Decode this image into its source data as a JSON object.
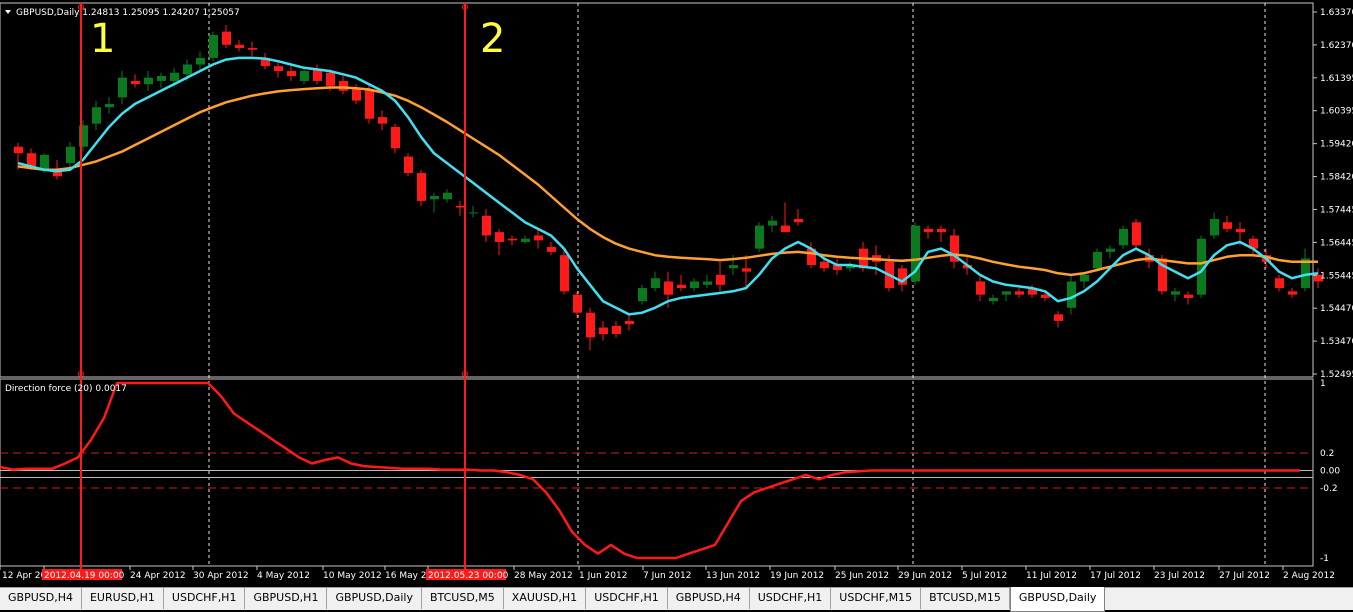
{
  "window": {
    "symbol_info": "GBPUSD,Daily  1.24813 1.25095 1.24207 1.25057",
    "indicator_label": "Direction force (20) 0.0017"
  },
  "annotations": {
    "marker_1": "1",
    "marker_2": "2"
  },
  "main_price_axis": [
    "1.63370",
    "1.62370",
    "1.61395",
    "1.60395",
    "1.59420",
    "1.58420",
    "1.57445",
    "1.56445",
    "1.55445",
    "1.54470",
    "1.53470",
    "1.52495"
  ],
  "indicator_axis": [
    "1",
    "0.2",
    "0.00",
    "-0.2",
    "-1"
  ],
  "time_axis": [
    "12 Apr 20",
    "2012.04.19 00:00",
    "24 Apr 2012",
    "30 Apr 2012",
    "4 May 2012",
    "10 May 2012",
    "16 May 2",
    "2012.05.23 00:00",
    "28 May 2012",
    "1 Jun 2012",
    "7 Jun 2012",
    "13 Jun 2012",
    "19 Jun 2012",
    "25 Jun 2012",
    "29 Jun 2012",
    "5 Jul 2012",
    "11 Jul 2012",
    "17 Jul 2012",
    "23 Jul 2012",
    "27 Jul 2012",
    "2 Aug 2012"
  ],
  "tabs": [
    {
      "label": "GBPUSD,H4",
      "active": false
    },
    {
      "label": "EURUSD,H1",
      "active": false
    },
    {
      "label": "USDCHF,H1",
      "active": false
    },
    {
      "label": "GBPUSD,H1",
      "active": false
    },
    {
      "label": "GBPUSD,Daily",
      "active": false
    },
    {
      "label": "BTCUSD,M5",
      "active": false
    },
    {
      "label": "XAUUSD,H1",
      "active": false
    },
    {
      "label": "USDCHF,H1",
      "active": false
    },
    {
      "label": "GBPUSD,H4",
      "active": false
    },
    {
      "label": "USDCHF,H1",
      "active": false
    },
    {
      "label": "USDCHF,M15",
      "active": false
    },
    {
      "label": "BTCUSD,M15",
      "active": false
    },
    {
      "label": "GBPUSD,Daily",
      "active": true
    }
  ],
  "colors": {
    "bull": "#0b7a1e",
    "bear": "#ff1a1a",
    "ma_fast": "#40e0f0",
    "ma_slow": "#ffa030",
    "indicator": "#ff1a1a",
    "marker_text": "#ffff40",
    "grid": "#ffffff"
  },
  "chart_data": {
    "type": "candlestick",
    "symbol": "GBPUSD",
    "timeframe": "Daily",
    "ylim": [
      1.52495,
      1.6387
    ],
    "candles": [
      [
        1.595,
        1.5962,
        1.588,
        1.593
      ],
      [
        1.593,
        1.5945,
        1.588,
        1.589
      ],
      [
        1.588,
        1.593,
        1.587,
        1.5925
      ],
      [
        1.588,
        1.591,
        1.585,
        1.586
      ],
      [
        1.59,
        1.5965,
        1.588,
        1.595
      ],
      [
        1.595,
        1.603,
        1.5935,
        1.6015
      ],
      [
        1.602,
        1.609,
        1.6,
        1.607
      ],
      [
        1.607,
        1.61,
        1.605,
        1.608
      ],
      [
        1.61,
        1.618,
        1.608,
        1.616
      ],
      [
        1.615,
        1.617,
        1.613,
        1.614
      ],
      [
        1.614,
        1.618,
        1.612,
        1.616
      ],
      [
        1.615,
        1.6175,
        1.613,
        1.6165
      ],
      [
        1.615,
        1.619,
        1.613,
        1.6175
      ],
      [
        1.617,
        1.6215,
        1.615,
        1.62
      ],
      [
        1.62,
        1.624,
        1.618,
        1.622
      ],
      [
        1.622,
        1.63,
        1.621,
        1.629
      ],
      [
        1.63,
        1.632,
        1.625,
        1.626
      ],
      [
        1.626,
        1.6275,
        1.624,
        1.625
      ],
      [
        1.625,
        1.627,
        1.6225,
        1.6245
      ],
      [
        1.622,
        1.6235,
        1.6185,
        1.6195
      ],
      [
        1.6195,
        1.621,
        1.616,
        1.618
      ],
      [
        1.618,
        1.62,
        1.615,
        1.6165
      ],
      [
        1.615,
        1.619,
        1.614,
        1.618
      ],
      [
        1.6185,
        1.62,
        1.614,
        1.615
      ],
      [
        1.6175,
        1.6185,
        1.612,
        1.6135
      ],
      [
        1.615,
        1.6165,
        1.611,
        1.612
      ],
      [
        1.6125,
        1.614,
        1.608,
        1.609
      ],
      [
        1.6125,
        1.614,
        1.602,
        1.6035
      ],
      [
        1.604,
        1.606,
        1.6,
        1.602
      ],
      [
        1.601,
        1.602,
        1.593,
        1.5945
      ],
      [
        1.592,
        1.593,
        1.586,
        1.587
      ],
      [
        1.587,
        1.588,
        1.577,
        1.5785
      ],
      [
        1.579,
        1.581,
        1.575,
        1.58
      ],
      [
        1.579,
        1.582,
        1.578,
        1.581
      ],
      [
        1.577,
        1.5785,
        1.574,
        1.5765
      ],
      [
        1.575,
        1.577,
        1.5735,
        1.575
      ],
      [
        1.574,
        1.576,
        1.566,
        1.568
      ],
      [
        1.569,
        1.57,
        1.562,
        1.566
      ],
      [
        1.567,
        1.568,
        1.565,
        1.5665
      ],
      [
        1.566,
        1.568,
        1.5655,
        1.567
      ],
      [
        1.568,
        1.57,
        1.564,
        1.5665
      ],
      [
        1.5645,
        1.566,
        1.562,
        1.563
      ],
      [
        1.562,
        1.564,
        1.55,
        1.551
      ],
      [
        1.55,
        1.551,
        1.543,
        1.5445
      ],
      [
        1.5445,
        1.546,
        1.533,
        1.537
      ],
      [
        1.54,
        1.542,
        1.536,
        1.538
      ],
      [
        1.5405,
        1.542,
        1.537,
        1.538
      ],
      [
        1.542,
        1.544,
        1.539,
        1.541
      ],
      [
        1.548,
        1.553,
        1.547,
        1.552
      ],
      [
        1.552,
        1.557,
        1.551,
        1.555
      ],
      [
        1.554,
        1.557,
        1.546,
        1.55
      ],
      [
        1.553,
        1.556,
        1.551,
        1.552
      ],
      [
        1.552,
        1.555,
        1.551,
        1.554
      ],
      [
        1.553,
        1.556,
        1.552,
        1.554
      ],
      [
        1.556,
        1.56,
        1.551,
        1.553
      ],
      [
        1.558,
        1.562,
        1.556,
        1.559
      ],
      [
        1.558,
        1.562,
        1.552,
        1.557
      ],
      [
        1.564,
        1.572,
        1.563,
        1.571
      ],
      [
        1.571,
        1.574,
        1.569,
        1.5725
      ],
      [
        1.571,
        1.578,
        1.569,
        1.569
      ],
      [
        1.573,
        1.576,
        1.571,
        1.572
      ],
      [
        1.564,
        1.566,
        1.558,
        1.559
      ],
      [
        1.56,
        1.562,
        1.557,
        1.558
      ],
      [
        1.559,
        1.561,
        1.556,
        1.5575
      ],
      [
        1.558,
        1.56,
        1.557,
        1.559
      ],
      [
        1.564,
        1.566,
        1.557,
        1.558
      ],
      [
        1.562,
        1.565,
        1.556,
        1.56
      ],
      [
        1.56,
        1.562,
        1.551,
        1.552
      ],
      [
        1.558,
        1.559,
        1.551,
        1.553
      ],
      [
        1.554,
        1.572,
        1.553,
        1.571
      ],
      [
        1.57,
        1.571,
        1.567,
        1.569
      ],
      [
        1.57,
        1.571,
        1.566,
        1.569
      ],
      [
        1.568,
        1.57,
        1.558,
        1.56
      ],
      [
        1.559,
        1.562,
        1.556,
        1.558
      ],
      [
        1.554,
        1.556,
        1.548,
        1.55
      ],
      [
        1.548,
        1.55,
        1.547,
        1.549
      ],
      [
        1.55,
        1.551,
        1.548,
        1.551
      ],
      [
        1.551,
        1.552,
        1.549,
        1.55
      ],
      [
        1.552,
        1.553,
        1.549,
        1.55
      ],
      [
        1.55,
        1.551,
        1.548,
        1.549
      ],
      [
        1.544,
        1.545,
        1.54,
        1.542
      ],
      [
        1.546,
        1.556,
        1.544,
        1.554
      ],
      [
        1.554,
        1.557,
        1.552,
        1.556
      ],
      [
        1.558,
        1.564,
        1.557,
        1.563
      ],
      [
        1.563,
        1.565,
        1.561,
        1.564
      ],
      [
        1.565,
        1.571,
        1.564,
        1.57
      ],
      [
        1.572,
        1.573,
        1.564,
        1.565
      ],
      [
        1.562,
        1.564,
        1.558,
        1.56
      ],
      [
        1.561,
        1.562,
        1.55,
        1.551
      ],
      [
        1.55,
        1.552,
        1.548,
        1.551
      ],
      [
        1.55,
        1.551,
        1.547,
        1.549
      ],
      [
        1.55,
        1.568,
        1.549,
        1.567
      ],
      [
        1.568,
        1.575,
        1.567,
        1.573
      ],
      [
        1.572,
        1.574,
        1.569,
        1.57
      ],
      [
        1.57,
        1.572,
        1.565,
        1.569
      ],
      [
        1.567,
        1.568,
        1.562,
        1.564
      ],
      [
        1.562,
        1.564,
        1.558,
        1.56
      ],
      [
        1.555,
        1.556,
        1.551,
        1.552
      ],
      [
        1.551,
        1.552,
        1.549,
        1.55
      ],
      [
        1.552,
        1.564,
        1.551,
        1.561
      ],
      [
        1.556,
        1.558,
        1.552,
        1.554
      ]
    ],
    "ma_fast": [
      1.59,
      1.589,
      1.588,
      1.5875,
      1.588,
      1.591,
      1.596,
      1.601,
      1.605,
      1.608,
      1.61,
      1.612,
      1.614,
      1.616,
      1.618,
      1.62,
      1.6215,
      1.622,
      1.622,
      1.6218,
      1.621,
      1.62,
      1.619,
      1.6185,
      1.618,
      1.617,
      1.616,
      1.614,
      1.612,
      1.609,
      1.604,
      1.598,
      1.593,
      1.59,
      1.587,
      1.584,
      1.581,
      1.578,
      1.575,
      1.572,
      1.57,
      1.568,
      1.564,
      1.558,
      1.553,
      1.548,
      1.546,
      1.544,
      1.5445,
      1.546,
      1.548,
      1.549,
      1.5495,
      1.55,
      1.5505,
      1.551,
      1.552,
      1.556,
      1.561,
      1.564,
      1.566,
      1.564,
      1.561,
      1.559,
      1.559,
      1.5585,
      1.558,
      1.556,
      1.554,
      1.557,
      1.563,
      1.564,
      1.562,
      1.559,
      1.556,
      1.554,
      1.553,
      1.5525,
      1.552,
      1.551,
      1.548,
      1.549,
      1.551,
      1.554,
      1.558,
      1.562,
      1.564,
      1.562,
      1.559,
      1.557,
      1.555,
      1.557,
      1.562,
      1.565,
      1.566,
      1.564,
      1.561,
      1.557,
      1.555,
      1.556,
      1.5565
    ],
    "ma_slow": [
      1.589,
      1.5885,
      1.588,
      1.588,
      1.5885,
      1.5895,
      1.5905,
      1.592,
      1.5935,
      1.5955,
      1.5975,
      1.5995,
      1.6015,
      1.6035,
      1.6055,
      1.607,
      1.6085,
      1.6095,
      1.6105,
      1.6112,
      1.6118,
      1.6122,
      1.6125,
      1.6128,
      1.613,
      1.613,
      1.6128,
      1.6124,
      1.6115,
      1.6105,
      1.609,
      1.607,
      1.6048,
      1.6025,
      1.6,
      1.5975,
      1.595,
      1.5925,
      1.5895,
      1.5865,
      1.5835,
      1.58,
      1.5765,
      1.573,
      1.57,
      1.5675,
      1.5655,
      1.564,
      1.563,
      1.562,
      1.5615,
      1.5612,
      1.561,
      1.5608,
      1.5605,
      1.5608,
      1.5612,
      1.5618,
      1.5624,
      1.5628,
      1.563,
      1.5626,
      1.562,
      1.5615,
      1.5612,
      1.561,
      1.5608,
      1.5605,
      1.5603,
      1.5606,
      1.5612,
      1.5618,
      1.5622,
      1.5618,
      1.561,
      1.56,
      1.5592,
      1.5585,
      1.558,
      1.5575,
      1.5565,
      1.556,
      1.5565,
      1.5575,
      1.5585,
      1.5595,
      1.5605,
      1.561,
      1.5605,
      1.56,
      1.5595,
      1.5595,
      1.5605,
      1.5615,
      1.562,
      1.562,
      1.5615,
      1.5605,
      1.56,
      1.56,
      1.56
    ],
    "indicator": {
      "name": "Direction force (20)",
      "ylim": [
        -1,
        1
      ],
      "levels": [
        0.2,
        0,
        -0.2
      ],
      "values": [
        0.04,
        0.01,
        0.02,
        0.02,
        0.02,
        0.08,
        0.15,
        0.35,
        0.6,
        1.0,
        1.0,
        1.0,
        1.0,
        1.0,
        1.0,
        1.0,
        1.0,
        0.85,
        0.65,
        0.55,
        0.45,
        0.35,
        0.25,
        0.15,
        0.08,
        0.12,
        0.15,
        0.08,
        0.05,
        0.04,
        0.03,
        0.02,
        0.02,
        0.02,
        0.01,
        0.01,
        0.01,
        0.0,
        0.0,
        -0.02,
        -0.05,
        -0.1,
        -0.25,
        -0.45,
        -0.7,
        -0.85,
        -0.95,
        -0.85,
        -0.95,
        -1.0,
        -1.0,
        -1.0,
        -1.0,
        -0.95,
        -0.9,
        -0.85,
        -0.6,
        -0.35,
        -0.25,
        -0.2,
        -0.15,
        -0.1,
        -0.05,
        -0.1,
        -0.05,
        -0.02,
        -0.01,
        0.0,
        0.0,
        0.0,
        0.0,
        0.0,
        0.0,
        0.0,
        0.0,
        0.0,
        0.0,
        0.0,
        0.0,
        0.0,
        0.0,
        0.0,
        0.0,
        0.0,
        0.0,
        0.0,
        0.0,
        0.0,
        0.0,
        0.0,
        0.0,
        0.0,
        0.0,
        0.0,
        0.0,
        0.0,
        0.0,
        0.0,
        0.0,
        0.0,
        0.0
      ]
    },
    "vlines": [
      {
        "time": "2012.04.19 00:00",
        "label": "1"
      },
      {
        "time": "2012.05.23 00:00",
        "label": "2"
      }
    ]
  }
}
